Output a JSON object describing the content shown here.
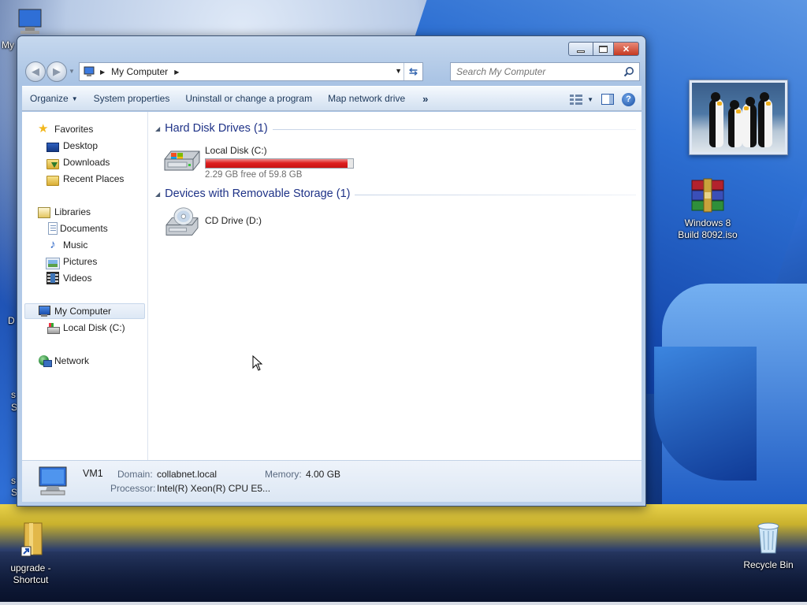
{
  "window": {
    "address": {
      "location": "My Computer"
    },
    "search": {
      "placeholder": "Search My Computer"
    },
    "toolbar": {
      "organize": "Organize",
      "system_properties": "System properties",
      "uninstall": "Uninstall or change a program",
      "map_network_drive": "Map network drive",
      "more": "»"
    },
    "nav_pane": {
      "favorites": "Favorites",
      "favorites_items": [
        "Desktop",
        "Downloads",
        "Recent Places"
      ],
      "libraries": "Libraries",
      "libraries_items": [
        "Documents",
        "Music",
        "Pictures",
        "Videos"
      ],
      "computer": "My Computer",
      "computer_items": [
        "Local Disk (C:)"
      ],
      "network": "Network"
    },
    "content": {
      "groups": [
        {
          "title": "Hard Disk Drives (1)",
          "drives": [
            {
              "name": "Local Disk (C:)",
              "free_text": "2.29 GB free of 59.8 GB",
              "used_fraction": 0.962
            }
          ]
        },
        {
          "title": "Devices with Removable Storage (1)",
          "drives": [
            {
              "name": "CD Drive (D:)"
            }
          ]
        }
      ]
    },
    "details": {
      "computer_name": "VM1",
      "domain_label": "Domain:",
      "domain_value": "collabnet.local",
      "memory_label": "Memory:",
      "memory_value": "4.00 GB",
      "processor_label": "Processor:",
      "processor_value": "Intel(R) Xeon(R) CPU E5..."
    },
    "colors": {
      "usage_bar": "#dd1f1f",
      "group_title": "#1e3287",
      "toolbar_text": "#1e395b"
    }
  },
  "desktop": {
    "icons": {
      "top_left_partial": "My",
      "winrar_iso": "Windows 8\nBuild 8092.iso",
      "shortcut": "upgrade -\nShortcut",
      "recycle_bin": "Recycle Bin"
    },
    "left_edge_fragments": [
      "D",
      "s",
      "S",
      "s",
      "S"
    ]
  }
}
